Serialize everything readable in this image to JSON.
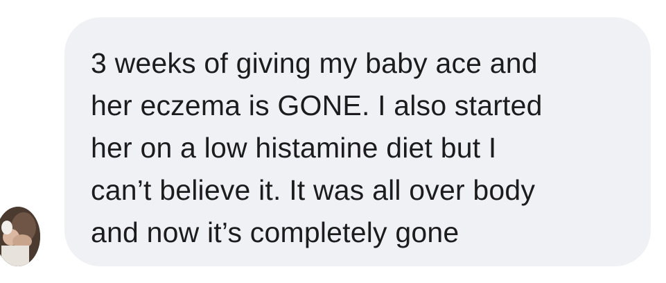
{
  "conversation": {
    "messages": [
      {
        "sender_avatar": "user-avatar-photo",
        "text": "3 weeks of giving my baby ace and\nher eczema is GONE. I also started\nher on a low histamine diet but I\ncan’t believe it. It was all over body\nand now it’s completely gone"
      }
    ]
  },
  "colors": {
    "bubble_background": "#f0f1f5",
    "text": "#1c1c1e",
    "page_background": "#ffffff"
  }
}
